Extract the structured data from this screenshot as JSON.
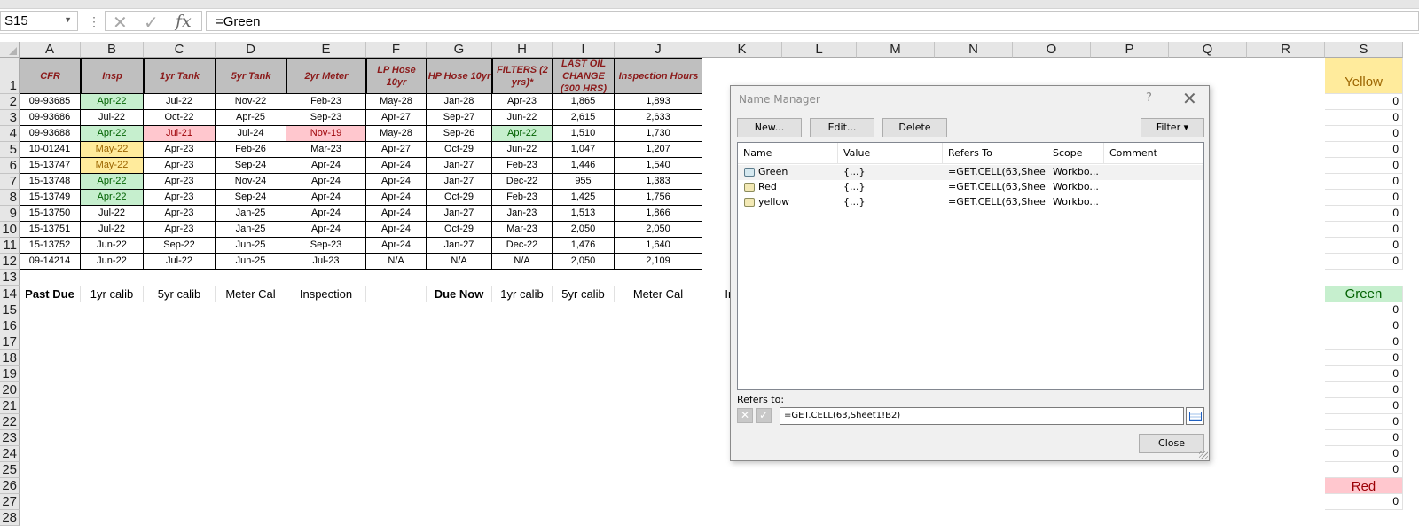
{
  "formula_bar": {
    "name_box": "S15",
    "formula": "=Green",
    "cancel_icon": "✕",
    "enter_icon": "✓",
    "fx_label": "fx"
  },
  "columns": [
    "A",
    "B",
    "C",
    "D",
    "E",
    "F",
    "G",
    "H",
    "I",
    "J",
    "K",
    "L",
    "M",
    "N",
    "O",
    "P",
    "Q",
    "R",
    "S"
  ],
  "rows": [
    "1",
    "2",
    "3",
    "4",
    "5",
    "6",
    "7",
    "8",
    "9",
    "10",
    "11",
    "12",
    "13",
    "14",
    "15",
    "16",
    "17",
    "18",
    "19",
    "20",
    "21",
    "22",
    "23",
    "24",
    "25",
    "26",
    "27",
    "28"
  ],
  "headers": [
    "CFR",
    "Insp",
    "1yr Tank",
    "5yr Tank",
    "2yr Meter",
    "LP Hose 10yr",
    "HP Hose 10yr",
    "FILTERS (2 yrs)*",
    "LAST OIL CHANGE (300 HRS)",
    "Inspection Hours"
  ],
  "table": [
    [
      "09-93685",
      "Apr-22",
      "Jul-22",
      "Nov-22",
      "Feb-23",
      "May-28",
      "Jan-28",
      "Apr-23",
      "1,865",
      "1,893"
    ],
    [
      "09-93686",
      "Jul-22",
      "Oct-22",
      "Apr-25",
      "Sep-23",
      "Apr-27",
      "Sep-27",
      "Jun-22",
      "2,615",
      "2,633"
    ],
    [
      "09-93688",
      "Apr-22",
      "Jul-21",
      "Jul-24",
      "Nov-19",
      "May-28",
      "Sep-26",
      "Apr-22",
      "1,510",
      "1,730"
    ],
    [
      "10-01241",
      "May-22",
      "Apr-23",
      "Feb-26",
      "Mar-23",
      "Apr-27",
      "Oct-29",
      "Jun-22",
      "1,047",
      "1,207"
    ],
    [
      "15-13747",
      "May-22",
      "Apr-23",
      "Sep-24",
      "Apr-24",
      "Apr-24",
      "Jan-27",
      "Feb-23",
      "1,446",
      "1,540"
    ],
    [
      "15-13748",
      "Apr-22",
      "Apr-23",
      "Nov-24",
      "Apr-24",
      "Apr-24",
      "Jan-27",
      "Dec-22",
      "955",
      "1,383"
    ],
    [
      "15-13749",
      "Apr-22",
      "Apr-23",
      "Sep-24",
      "Apr-24",
      "Apr-24",
      "Oct-29",
      "Feb-23",
      "1,425",
      "1,756"
    ],
    [
      "15-13750",
      "Jul-22",
      "Apr-23",
      "Jan-25",
      "Apr-24",
      "Apr-24",
      "Jan-27",
      "Jan-23",
      "1,513",
      "1,866"
    ],
    [
      "15-13751",
      "Jul-22",
      "Apr-23",
      "Jan-25",
      "Apr-24",
      "Apr-24",
      "Oct-29",
      "Mar-23",
      "2,050",
      "2,050"
    ],
    [
      "15-13752",
      "Jun-22",
      "Sep-22",
      "Jun-25",
      "Sep-23",
      "Apr-24",
      "Jan-27",
      "Dec-22",
      "1,476",
      "1,640"
    ],
    [
      "09-14214",
      "Jun-22",
      "Jul-22",
      "Jun-25",
      "Jul-23",
      "N/A",
      "N/A",
      "N/A",
      "2,050",
      "2,109"
    ]
  ],
  "highlights": [
    {
      "row": 0,
      "col": 1,
      "style": "green"
    },
    {
      "row": 2,
      "col": 1,
      "style": "green"
    },
    {
      "row": 2,
      "col": 2,
      "style": "red"
    },
    {
      "row": 2,
      "col": 4,
      "style": "red"
    },
    {
      "row": 2,
      "col": 7,
      "style": "green"
    },
    {
      "row": 3,
      "col": 1,
      "style": "yellow"
    },
    {
      "row": 4,
      "col": 1,
      "style": "yellow"
    },
    {
      "row": 5,
      "col": 1,
      "style": "green"
    },
    {
      "row": 6,
      "col": 1,
      "style": "green"
    }
  ],
  "row14": [
    "Past Due",
    "1yr calib",
    "5yr calib",
    "Meter Cal",
    "Inspection",
    "",
    "Due Now",
    "1yr calib",
    "5yr calib",
    "Meter Cal",
    "Inspec"
  ],
  "row14_bold": [
    0,
    6
  ],
  "col_s": {
    "yellow": "Yellow",
    "green": "Green",
    "red": "Red",
    "zero": "0"
  },
  "colors": {
    "green_fill": "#c6efce",
    "yellow_fill": "#ffeb9c",
    "red_fill": "#ffc7ce",
    "header_fill": "#bfbfbf",
    "header_text": "#8b1a1a"
  },
  "name_manager": {
    "title": "Name Manager",
    "help": "?",
    "close_x": "✕",
    "new_label": "New...",
    "edit_label": "Edit...",
    "delete_label": "Delete",
    "filter_label": "Filter ▾",
    "columns": [
      "Name",
      "Value",
      "Refers To",
      "Scope",
      "Comment"
    ],
    "names": [
      {
        "name": "Green",
        "value": "{...}",
        "refers": "=GET.CELL(63,Shee...",
        "scope": "Workbo..."
      },
      {
        "name": "Red",
        "value": "{...}",
        "refers": "=GET.CELL(63,Shee...",
        "scope": "Workbo..."
      },
      {
        "name": "yellow",
        "value": "{...}",
        "refers": "=GET.CELL(63,Shee...",
        "scope": "Workbo..."
      }
    ],
    "refers_label": "Refers to:",
    "refers_value": "=GET.CELL(63,Sheet1!B2)",
    "close_label": "Close"
  }
}
